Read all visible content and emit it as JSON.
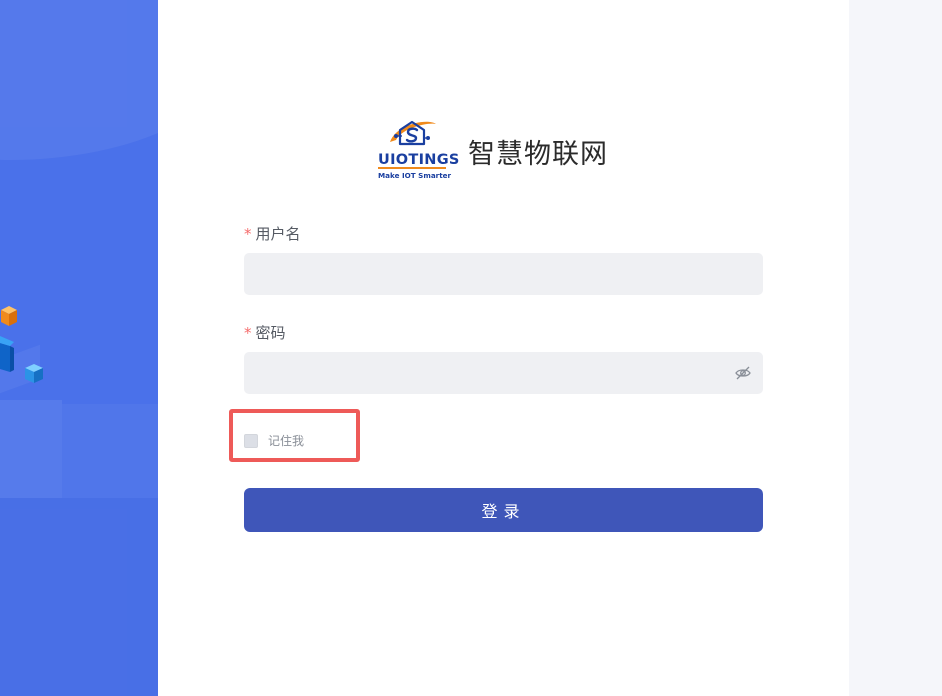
{
  "colors": {
    "left_panel": "#4a71ea",
    "card_bg": "#ffffff",
    "right_panel": "#f5f6fa",
    "input_bg": "#eff0f3",
    "primary_button": "#3f56b9",
    "required_mark": "#f56c6c",
    "highlight_border": "#ee5a58",
    "logo_orange": "#f08a1c",
    "logo_blue": "#1a3fa0"
  },
  "brand": {
    "logo_text": "UIOTINGS",
    "logo_tagline": "Make IOT Smarter",
    "title": "智慧物联网"
  },
  "form": {
    "username": {
      "required_mark": "*",
      "label": "用户名",
      "value": "",
      "placeholder": ""
    },
    "password": {
      "required_mark": "*",
      "label": "密码",
      "value": "",
      "placeholder": "",
      "toggle_icon": "eye-off-icon"
    },
    "remember": {
      "label": "记住我",
      "checked": false
    },
    "submit_label": "登录"
  },
  "decoration": {
    "cube_icons": [
      "orange-cube-icon",
      "blue-cube-icon",
      "small-blue-cube-icon"
    ],
    "highlight_target": "remember-me"
  }
}
